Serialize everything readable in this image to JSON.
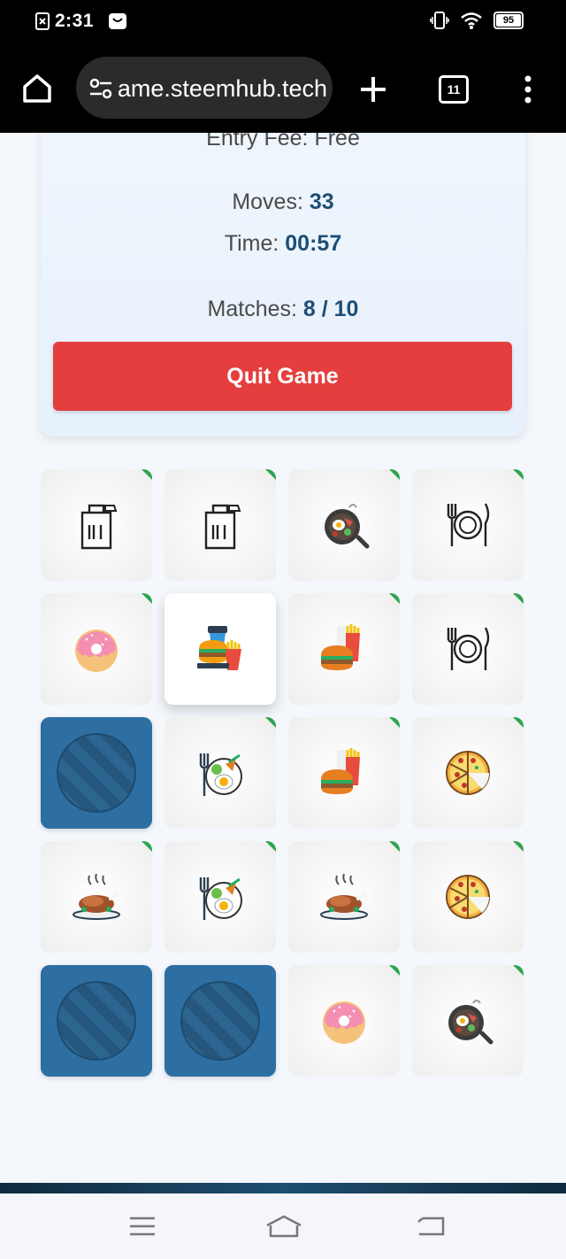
{
  "status_bar": {
    "time": "2:31",
    "battery": "95"
  },
  "browser": {
    "url": "game.steemhub.tech",
    "tab_count": "11"
  },
  "game_info": {
    "entry_fee_label": "Entry Fee:",
    "entry_fee_value": "Free",
    "moves_label": "Moves:",
    "moves_value": "33",
    "time_label": "Time:",
    "time_value": "00:57",
    "matches_label": "Matches:",
    "matches_value": "8 / 10",
    "quit_label": "Quit Game"
  },
  "board": {
    "cards": [
      {
        "state": "matched",
        "icon": "takeaway-bag-icon"
      },
      {
        "state": "matched",
        "icon": "takeaway-bag-icon"
      },
      {
        "state": "matched",
        "icon": "breakfast-pan-icon"
      },
      {
        "state": "matched",
        "icon": "plate-cutlery-icon"
      },
      {
        "state": "matched",
        "icon": "donut-icon"
      },
      {
        "state": "open",
        "icon": "fast-food-icon"
      },
      {
        "state": "matched",
        "icon": "burger-fries-icon"
      },
      {
        "state": "matched",
        "icon": "plate-cutlery-icon"
      },
      {
        "state": "hidden",
        "icon": "card-back-icon"
      },
      {
        "state": "matched",
        "icon": "salad-egg-plate-icon"
      },
      {
        "state": "matched",
        "icon": "burger-fries-icon"
      },
      {
        "state": "matched",
        "icon": "pizza-icon"
      },
      {
        "state": "matched",
        "icon": "roast-chicken-icon"
      },
      {
        "state": "matched",
        "icon": "salad-egg-plate-icon"
      },
      {
        "state": "matched",
        "icon": "roast-chicken-icon"
      },
      {
        "state": "matched",
        "icon": "pizza-icon"
      },
      {
        "state": "hidden",
        "icon": "card-back-icon"
      },
      {
        "state": "hidden",
        "icon": "card-back-icon"
      },
      {
        "state": "matched",
        "icon": "donut-icon"
      },
      {
        "state": "matched",
        "icon": "breakfast-pan-icon"
      }
    ]
  },
  "colors": {
    "quit_button": "#e53e3e",
    "stat_value": "#1e4e75",
    "card_back": "#2d6fa3",
    "matched_marker": "#2ea44f"
  }
}
